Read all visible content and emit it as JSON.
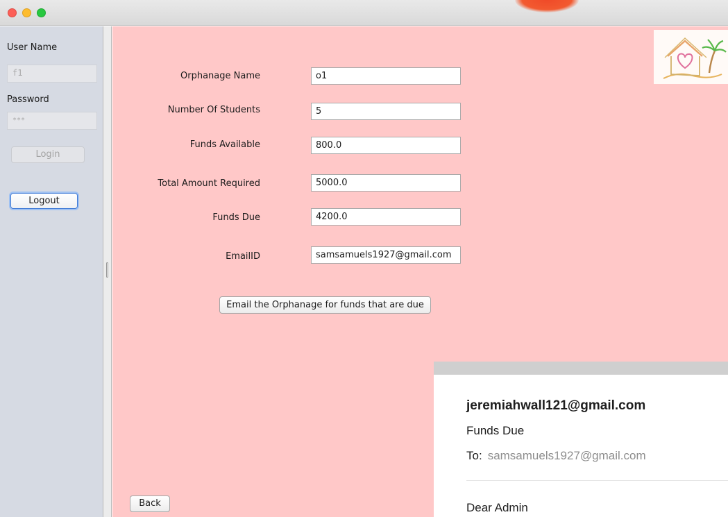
{
  "login": {
    "username_label": "User Name",
    "username_value": "f1",
    "password_label": "Password",
    "password_value": "***",
    "login_button": "Login",
    "logout_button": "Logout"
  },
  "form": {
    "fields": [
      {
        "label": "Orphanage Name",
        "value": "o1"
      },
      {
        "label": "Number Of Students",
        "value": "5"
      },
      {
        "label": "Funds Available",
        "value": "800.0"
      },
      {
        "label": "Total Amount Required",
        "value": "5000.0"
      },
      {
        "label": "Funds Due",
        "value": "4200.0"
      },
      {
        "label": "EmailID",
        "value": "samsamuels1927@gmail.com"
      }
    ],
    "email_button": "Email the Orphanage for funds that are due",
    "back_button": "Back"
  },
  "email": {
    "from": "jeremiahwall121@gmail.com",
    "subject": "Funds Due",
    "to_label": "To:",
    "to_address": "samsamuels1927@gmail.com",
    "greeting": "Dear Admin"
  },
  "colors": {
    "main_background": "#ffc8c8",
    "sidebar_background": "#d6dae3",
    "logout_focus_ring": "#3d79d6"
  },
  "icons": [
    "house-heart-palm-logo"
  ]
}
